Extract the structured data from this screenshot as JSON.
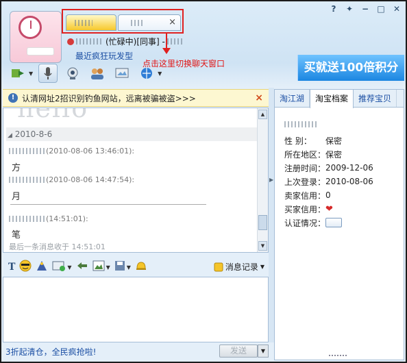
{
  "window": {
    "help_label": "?",
    "pin_label": "✦",
    "min_label": "−",
    "max_label": "□",
    "close_label": "✕"
  },
  "chat_tab": {
    "close_label": "×"
  },
  "status": {
    "state_text": "(忙碌中)[同事] -"
  },
  "signature": "最近疯狂玩发型",
  "annotation": "点击这里切换聊天窗口",
  "ad_text": "买就送100倍积分",
  "notice": {
    "text": "认清网址2招识别钓鱼网站，远离被骗被盗>>>",
    "close_label": "×"
  },
  "chat": {
    "ghost_text": "hello",
    "date": "2010-8-6",
    "messages": [
      {
        "time": "(2010-08-06 13:46:01):",
        "text": "方"
      },
      {
        "time": "(2010-08-06 14:47:54):",
        "text": "月"
      },
      {
        "time": "(14:51:01):",
        "text": "笔"
      }
    ],
    "last_msg": "最后一条消息收于 14:51:01"
  },
  "format_bar": {
    "history_label": "消息记录"
  },
  "footer": {
    "promo": "3折起清仓，全民疯抢啦!",
    "send_label": "发送"
  },
  "right_panel": {
    "tabs": [
      "淘江湖",
      "淘宝档案",
      "推荐宝贝"
    ],
    "profile": [
      {
        "k": "性    别：",
        "v": "保密"
      },
      {
        "k": "所在地区：",
        "v": "保密"
      },
      {
        "k": "注册时间：",
        "v": "2009-12-06"
      },
      {
        "k": "上次登录：",
        "v": "2010-08-06"
      },
      {
        "k": "卖家信用：",
        "v": "0"
      },
      {
        "k": "买家信用：",
        "v": ""
      },
      {
        "k": "认证情况：",
        "v": ""
      }
    ]
  },
  "colors": {
    "accent": "#1a4ea3",
    "annotation": "#e02020",
    "tab_active": "#f7c82c"
  },
  "icons": [
    "help-icon",
    "pin-icon",
    "minimize-icon",
    "maximize-icon",
    "close-icon",
    "transfer-file-icon",
    "voice-icon",
    "video-icon",
    "group-icon",
    "remote-icon",
    "web-icon",
    "font-icon",
    "emoticon-icon",
    "magic-icon",
    "screenshot-icon",
    "shake-icon",
    "image-icon",
    "save-icon",
    "bell-icon"
  ]
}
